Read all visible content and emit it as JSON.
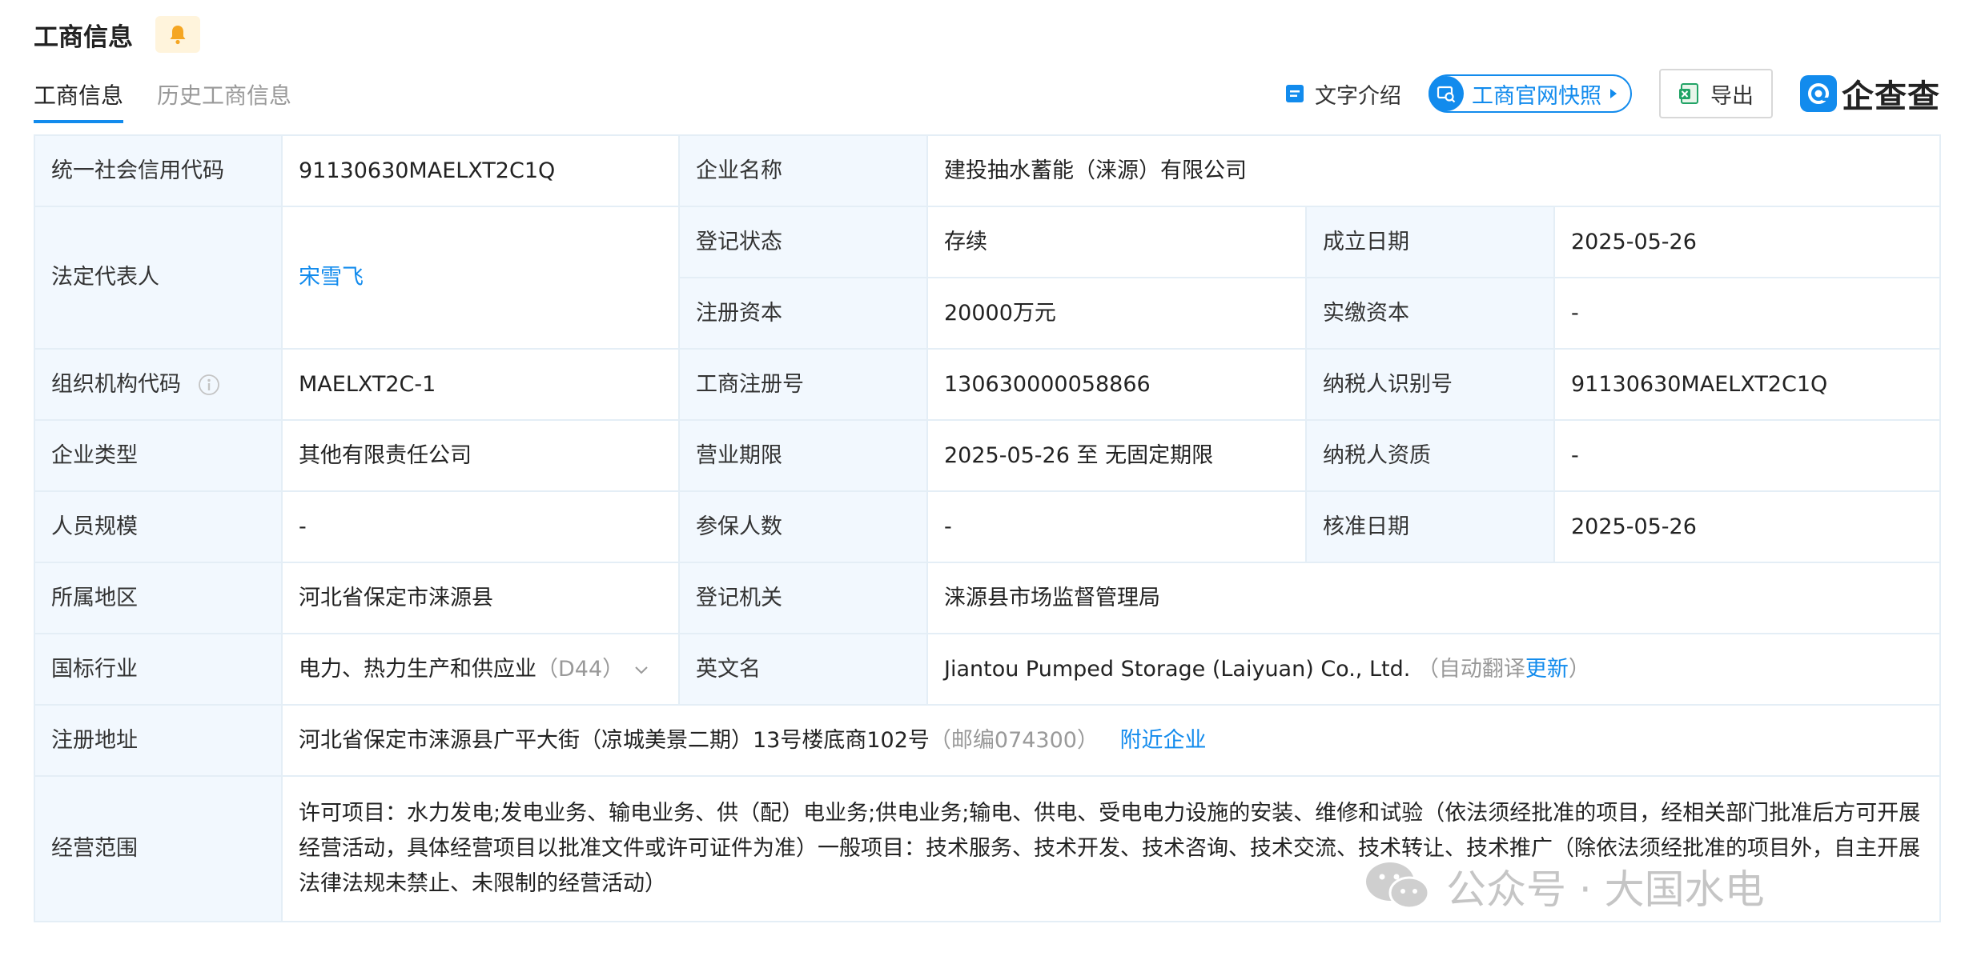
{
  "header": {
    "title": "工商信息",
    "bell_icon": "bell-icon"
  },
  "tabs": [
    {
      "label": "工商信息",
      "active": true
    },
    {
      "label": "历史工商信息",
      "active": false
    }
  ],
  "toolbar": {
    "text_intro": "文字介绍",
    "snapshot": "工商官网快照",
    "export": "导出",
    "logo": "企查查"
  },
  "fields": {
    "credit_code": {
      "label": "统一社会信用代码",
      "value": "91130630MAELXT2C1Q"
    },
    "company_name": {
      "label": "企业名称",
      "value": "建投抽水蓄能（涞源）有限公司"
    },
    "legal_rep": {
      "label": "法定代表人",
      "value": "宋雪飞"
    },
    "reg_status": {
      "label": "登记状态",
      "value": "存续"
    },
    "found_date": {
      "label": "成立日期",
      "value": "2025-05-26"
    },
    "reg_capital": {
      "label": "注册资本",
      "value": "20000万元"
    },
    "paid_capital": {
      "label": "实缴资本",
      "value": "-"
    },
    "org_code": {
      "label": "组织机构代码",
      "value": "MAELXT2C-1"
    },
    "reg_no": {
      "label": "工商注册号",
      "value": "130630000058866"
    },
    "tax_id": {
      "label": "纳税人识别号",
      "value": "91130630MAELXT2C1Q"
    },
    "company_type": {
      "label": "企业类型",
      "value": "其他有限责任公司"
    },
    "biz_term": {
      "label": "营业期限",
      "value": "2025-05-26 至 无固定期限"
    },
    "taxpayer_qual": {
      "label": "纳税人资质",
      "value": "-"
    },
    "staff_size": {
      "label": "人员规模",
      "value": "-"
    },
    "insured_count": {
      "label": "参保人数",
      "value": "-"
    },
    "approve_date": {
      "label": "核准日期",
      "value": "2025-05-26"
    },
    "region": {
      "label": "所属地区",
      "value": "河北省保定市涞源县"
    },
    "reg_authority": {
      "label": "登记机关",
      "value": "涞源县市场监督管理局"
    },
    "industry": {
      "label": "国标行业",
      "value": "电力、热力生产和供应业",
      "code": "（D44）"
    },
    "english_name": {
      "label": "英文名",
      "value": "Jiantou Pumped Storage (Laiyuan) Co., Ltd.",
      "note_prefix": "（自动翻译",
      "note_link": "更新",
      "note_suffix": "）"
    },
    "reg_address": {
      "label": "注册地址",
      "value": "河北省保定市涞源县广平大街（凉城美景二期）13号楼底商102号",
      "postcode": "（邮编074300）",
      "nearby": "附近企业"
    },
    "biz_scope": {
      "label": "经营范围",
      "value": "许可项目：水力发电;发电业务、输电业务、供（配）电业务;供电业务;输电、供电、受电电力设施的安装、维修和试验（依法须经批准的项目，经相关部门批准后方可开展经营活动，具体经营项目以批准文件或许可证件为准）一般项目：技术服务、技术开发、技术咨询、技术交流、技术转让、技术推广（除依法须经批准的项目外，自主开展法律法规未禁止、未限制的经营活动）"
    }
  },
  "watermark": {
    "text": "公众号 · 大国水电"
  },
  "colors": {
    "accent": "#128bed",
    "label_bg": "#f2f8fe",
    "border": "#e4eef6",
    "bell_bg": "#fff4dc",
    "bell": "#f5a623"
  }
}
